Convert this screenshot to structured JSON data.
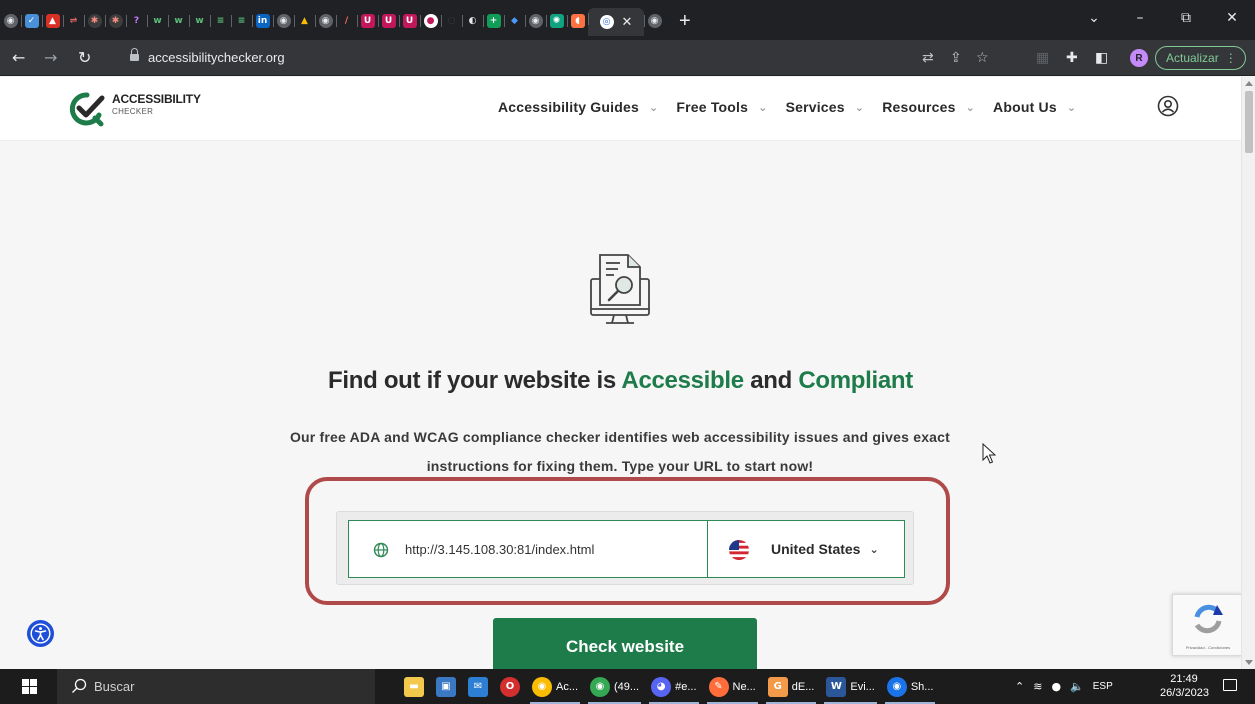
{
  "browser": {
    "tab_favicons": [
      {
        "name": "chrome-tab-icon",
        "glyph": "◉",
        "color": "#5f6368",
        "text": "#e8eaed",
        "shape": "circle"
      },
      {
        "name": "checkbox-tab-icon",
        "glyph": "✓",
        "color": "#4a90d9",
        "text": "#ffffff",
        "shape": "square"
      },
      {
        "name": "tree-tab-icon",
        "glyph": "▲",
        "color": "#d93025",
        "text": "#ffffff",
        "shape": "square"
      },
      {
        "name": "dumbbell-tab-icon",
        "glyph": "⇌",
        "color": "#202124",
        "text": "#e06666",
        "shape": "square"
      },
      {
        "name": "badge-tab-icon",
        "glyph": "✱",
        "color": "#3c3c3c",
        "text": "#f28b82",
        "shape": "circle"
      },
      {
        "name": "badge-tab-icon-2",
        "glyph": "✱",
        "color": "#3c3c3c",
        "text": "#f28b82",
        "shape": "circle"
      },
      {
        "name": "question-tab-icon",
        "glyph": "?",
        "color": "#202124",
        "text": "#c77dff",
        "shape": "square"
      },
      {
        "name": "w-tab-icon",
        "glyph": "w",
        "color": "#202124",
        "text": "#5bbf7a",
        "shape": "square"
      },
      {
        "name": "w-tab-icon-2",
        "glyph": "w",
        "color": "#202124",
        "text": "#5bbf7a",
        "shape": "square"
      },
      {
        "name": "w-tab-icon-3",
        "glyph": "w",
        "color": "#202124",
        "text": "#5bbf7a",
        "shape": "square"
      },
      {
        "name": "s-tab-icon",
        "glyph": "≡",
        "color": "#202124",
        "text": "#5bbf7a",
        "shape": "square"
      },
      {
        "name": "s-tab-icon-2",
        "glyph": "≡",
        "color": "#202124",
        "text": "#5bbf7a",
        "shape": "square"
      },
      {
        "name": "linkedin-tab-icon",
        "glyph": "in",
        "color": "#0a66c2",
        "text": "#ffffff",
        "shape": "square"
      },
      {
        "name": "globe-tab-icon",
        "glyph": "◉",
        "color": "#5f6368",
        "text": "#e8eaed",
        "shape": "circle"
      },
      {
        "name": "drive-tab-icon",
        "glyph": "▲",
        "color": "#202124",
        "text": "#fbbc04",
        "shape": "square"
      },
      {
        "name": "globe-tab-icon-2",
        "glyph": "◉",
        "color": "#5f6368",
        "text": "#e8eaed",
        "shape": "circle"
      },
      {
        "name": "pen-tab-icon",
        "glyph": "/",
        "color": "#202124",
        "text": "#ff6d5a",
        "shape": "square"
      },
      {
        "name": "u-tab-icon",
        "glyph": "U",
        "color": "#c2185b",
        "text": "#ffffff",
        "shape": "square"
      },
      {
        "name": "u-tab-icon-2",
        "glyph": "U",
        "color": "#c2185b",
        "text": "#ffffff",
        "shape": "square"
      },
      {
        "name": "u-tab-icon-3",
        "glyph": "U",
        "color": "#c2185b",
        "text": "#ffffff",
        "shape": "square"
      },
      {
        "name": "circle-tab-icon",
        "glyph": "●",
        "color": "#ffffff",
        "text": "#c2185b",
        "shape": "circle"
      },
      {
        "name": "dark-tab-icon",
        "glyph": "○",
        "color": "#202124",
        "text": "#3c3c3c",
        "shape": "circle"
      },
      {
        "name": "github-tab-icon",
        "glyph": "◐",
        "color": "#202124",
        "text": "#e8eaed",
        "shape": "circle"
      },
      {
        "name": "plus-tab-icon",
        "glyph": "+",
        "color": "#0f9d58",
        "text": "#ffffff",
        "shape": "square"
      },
      {
        "name": "diamond-tab-icon",
        "glyph": "◆",
        "color": "#202124",
        "text": "#4a9cff",
        "shape": "square"
      },
      {
        "name": "globe-tab-icon-3",
        "glyph": "◉",
        "color": "#5f6368",
        "text": "#e8eaed",
        "shape": "circle"
      },
      {
        "name": "chatgpt-tab-icon",
        "glyph": "✺",
        "color": "#10a37f",
        "text": "#ffffff",
        "shape": "square"
      },
      {
        "name": "orange-tab-icon",
        "glyph": "◖",
        "color": "#ff7043",
        "text": "#ffffff",
        "shape": "square"
      }
    ],
    "active_tab": {
      "favicon_glyph": "◎",
      "favicon_color": "#2f6fde"
    },
    "after_active_favicon": {
      "glyph": "◉",
      "color": "#5f6368"
    },
    "new_tab_label": "+",
    "window_controls": {
      "dropdown": "⌄",
      "minimize": "–",
      "restore": "⧉",
      "close": "✕"
    },
    "nav": {
      "back": "←",
      "forward": "→",
      "reload": "↻"
    },
    "url": "accessibilitychecker.org",
    "toolbar_icons": {
      "translate": "⇄",
      "share": "⇪",
      "star": "☆",
      "extension": "▦",
      "puzzle": "✚",
      "sidepanel": "◧"
    },
    "profile_initial": "R",
    "update_label": "Actualizar",
    "update_menu": "⋮"
  },
  "site": {
    "logo": {
      "title": "ACCESSIBILITY",
      "subtitle": "CHECKER",
      "color": "#1e7b4a"
    },
    "nav": [
      {
        "label": "Accessibility Guides",
        "chevron": "⌄"
      },
      {
        "label": "Free Tools",
        "chevron": "⌄"
      },
      {
        "label": "Services",
        "chevron": "⌄"
      },
      {
        "label": "Resources",
        "chevron": "⌄"
      },
      {
        "label": "About Us",
        "chevron": "⌄"
      }
    ],
    "hero": {
      "title_part1": "Find out if your website is ",
      "title_accent1": "Accessible",
      "title_part2": " and ",
      "title_accent2": "Compliant",
      "description": "Our free ADA and WCAG compliance checker identifies web accessibility issues and gives exact instructions for fixing them. Type your URL to start now!"
    },
    "form": {
      "url_value": "http://3.145.108.30:81/index.html",
      "country": "United States",
      "country_chevron": "⌄",
      "submit_label": "Check website"
    },
    "recaptcha_note": "Privacidad - Condiciones",
    "accent_color": "#1e7b4a",
    "highlight_color": "#b04a4a"
  },
  "taskbar": {
    "search_placeholder": "Buscar",
    "apps": [
      {
        "name": "file-explorer-app",
        "glyph": "▬",
        "color": "#f2c94c",
        "label": "",
        "round": false,
        "running": false
      },
      {
        "name": "store-app",
        "glyph": "▣",
        "color": "#3a78c3",
        "label": "",
        "round": false,
        "running": false
      },
      {
        "name": "mail-app",
        "glyph": "✉",
        "color": "#2d7fd3",
        "label": "",
        "round": false,
        "running": false
      },
      {
        "name": "opera-app",
        "glyph": "O",
        "color": "#d32f2f",
        "label": "",
        "round": true,
        "running": false
      },
      {
        "name": "chrome-app-1",
        "glyph": "◉",
        "color": "#fbbc04",
        "label": "Ac...",
        "round": true,
        "running": true
      },
      {
        "name": "chrome-app-2",
        "glyph": "◉",
        "color": "#34a853",
        "label": "(49...",
        "round": true,
        "running": true
      },
      {
        "name": "discord-app",
        "glyph": "◕",
        "color": "#5865f2",
        "label": "#e...",
        "round": true,
        "running": true
      },
      {
        "name": "notes-app",
        "glyph": "✎",
        "color": "#ff6d3b",
        "label": "Ne...",
        "round": true,
        "running": true
      },
      {
        "name": "pdf-app",
        "glyph": "G",
        "color": "#f2994a",
        "label": "dE...",
        "round": false,
        "running": true
      },
      {
        "name": "word-app",
        "glyph": "W",
        "color": "#2b579a",
        "label": "Evi...",
        "round": false,
        "running": true
      },
      {
        "name": "chromium-app",
        "glyph": "◉",
        "color": "#1a73e8",
        "label": "Sh...",
        "round": true,
        "running": true
      }
    ],
    "tray": {
      "chevron": "⌃",
      "network": "≋",
      "mic": "●",
      "volume": "🔈",
      "lang": "ESP"
    },
    "time": "21:49",
    "date": "26/3/2023"
  }
}
